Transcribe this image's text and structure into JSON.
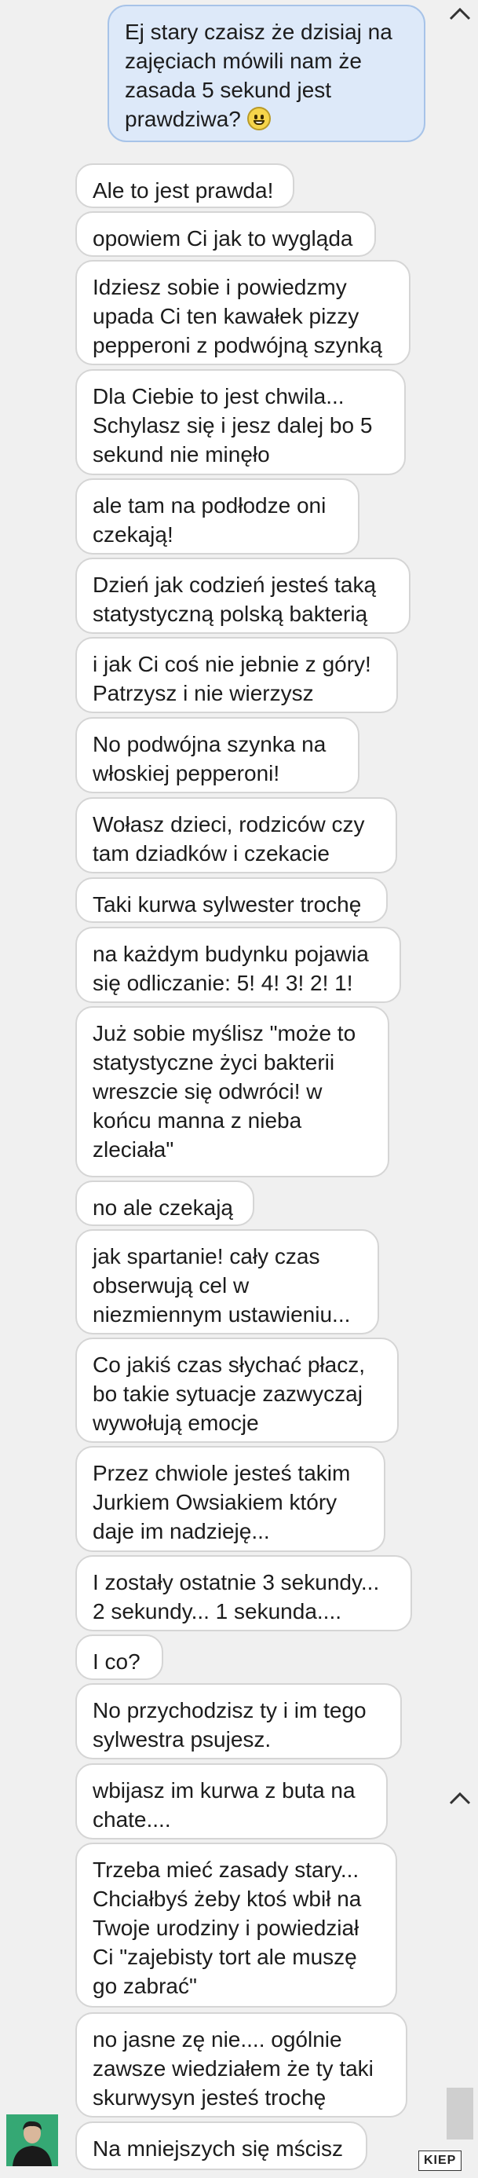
{
  "sent_message": {
    "text": "Ej stary czaisz że dzisiaj na zajęciach mówili nam że zasada 5 sekund jest prawdziwa?",
    "emoji": "grinning-face-emoji"
  },
  "received_messages": [
    "Ale to jest prawda!",
    "opowiem Ci jak to wygląda",
    "Idziesz sobie i powiedzmy upada Ci ten kawałek pizzy pepperoni z podwójną szynką",
    "Dla Ciebie to jest chwila... Schylasz się i jesz dalej bo 5 sekund nie minęło",
    "ale tam na podłodze oni czekają!",
    "Dzień jak codzień jesteś taką statystyczną polską bakterią",
    "i jak Ci coś nie jebnie z góry! Patrzysz i nie wierzysz",
    "No podwójna szynka na włoskiej pepperoni!",
    "Wołasz dzieci, rodziców czy tam dziadków i czekacie",
    "Taki kurwa sylwester trochę",
    "na każdym budynku pojawia się odliczanie: 5! 4! 3! 2! 1!",
    "Już sobie myślisz \"może to statystyczne życi bakterii wreszcie się odwróci! w końcu manna z nieba zleciała\"",
    "no ale czekają",
    "jak spartanie! cały czas obserwują cel w niezmiennym ustawieniu...",
    "Co jakiś czas słychać płacz, bo takie sytuacje zazwyczaj wywołują emocje",
    "Przez chwiole jesteś takim Jurkiem Owsiakiem który daje im nadzieję...",
    "I zostały ostatnie 3 sekundy... 2 sekundy... 1 sekunda....",
    "I co?",
    "No przychodzisz ty i im tego sylwestra psujesz.",
    "wbijasz im kurwa z buta na chate....",
    "Trzeba mieć zasady stary... Chciałbyś żeby ktoś wbił na Twoje urodziny i powiedział Ci \"zajebisty tort ale muszę go zabrać\"",
    "no jasne zę nie.... ogólnie zawsze wiedziałem że ty taki skurwysyn jesteś trochę",
    "Na mniejszych się mścisz"
  ],
  "watermark": "KIEP",
  "colors": {
    "sent_bubble": "#dde9f9",
    "sent_border": "#a7c3e8",
    "received_bubble": "#ffffff",
    "received_border": "#d5d5d5",
    "background": "#f0f0f0"
  },
  "icons": {
    "scroll_up": "chevron-up-icon",
    "avatar": "user-avatar"
  }
}
